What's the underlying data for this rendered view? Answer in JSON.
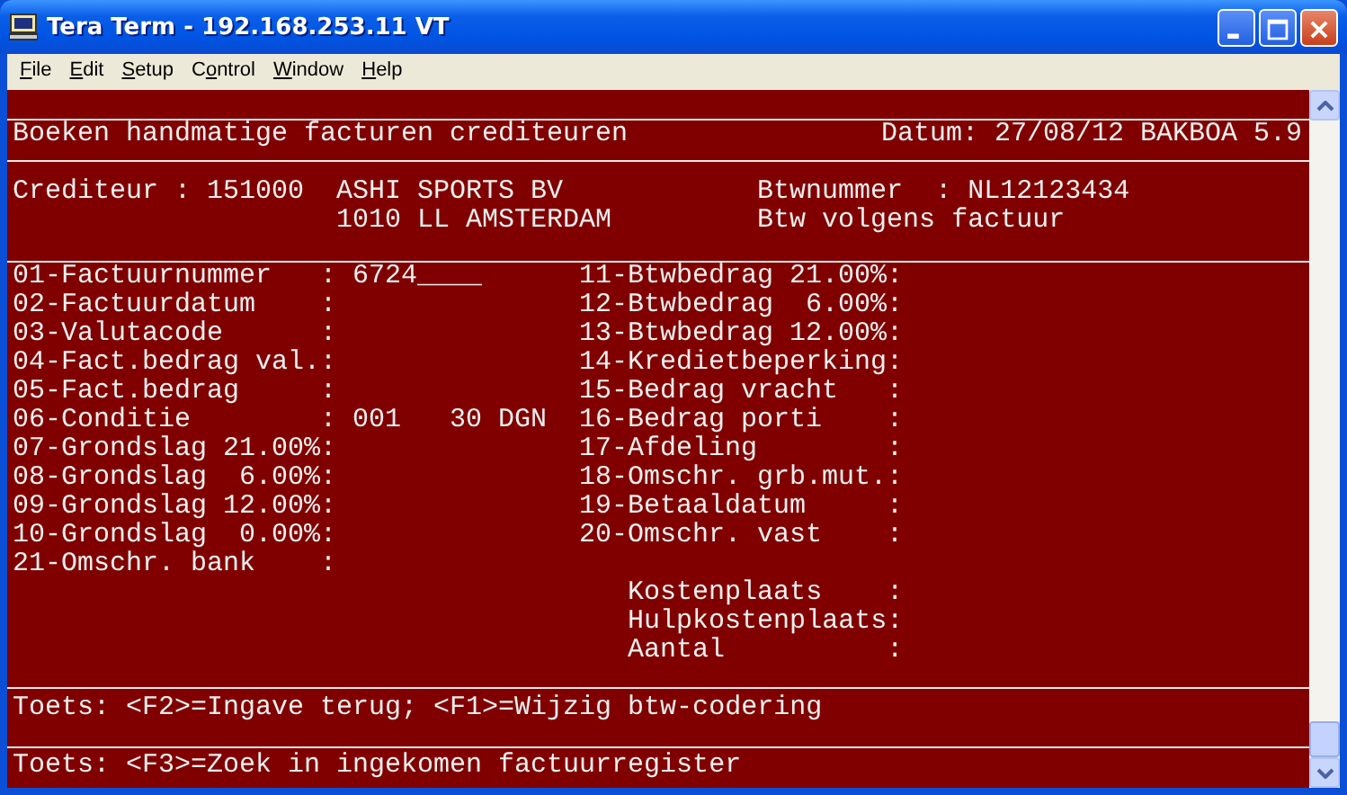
{
  "window": {
    "title": "Tera Term - 192.168.253.11 VT"
  },
  "menu": [
    {
      "mnemonic": "F",
      "rest": "ile"
    },
    {
      "mnemonic": "E",
      "rest": "dit"
    },
    {
      "mnemonic": "S",
      "rest": "etup"
    },
    {
      "before": "C",
      "mnemonic": "o",
      "rest": "ntrol"
    },
    {
      "mnemonic": "W",
      "rest": "indow"
    },
    {
      "mnemonic": "H",
      "rest": "elp"
    }
  ],
  "terminal": {
    "header": {
      "title": "Boeken handmatige facturen crediteuren",
      "date": "Datum: 27/08/12 BAKBOA 5.9"
    },
    "creditor": {
      "label": "Crediteur :",
      "number": "151000",
      "name": "ASHI SPORTS BV",
      "address": "1010 LL AMSTERDAM",
      "vat_label": "Btwnummer  :",
      "vat_number": "NL12123434",
      "vat_note": "Btw volgens factuur"
    },
    "fields_left": [
      {
        "label": "01-Factuurnummer   :",
        "value": "6724____"
      },
      {
        "label": "02-Factuurdatum    :"
      },
      {
        "label": "03-Valutacode      :"
      },
      {
        "label": "04-Fact.bedrag val.:"
      },
      {
        "label": "05-Fact.bedrag     :"
      },
      {
        "label": "06-Conditie        :",
        "value": "001   30 DGN"
      },
      {
        "label": "07-Grondslag 21.00%:"
      },
      {
        "label": "08-Grondslag  6.00%:"
      },
      {
        "label": "09-Grondslag 12.00%:"
      },
      {
        "label": "10-Grondslag  0.00%:"
      },
      {
        "label": "21-Omschr. bank    :"
      }
    ],
    "fields_right": [
      {
        "label": "11-Btwbedrag 21.00%:"
      },
      {
        "label": "12-Btwbedrag  6.00%:"
      },
      {
        "label": "13-Btwbedrag 12.00%:"
      },
      {
        "label": "14-Kredietbeperking:"
      },
      {
        "label": "15-Bedrag vracht   :"
      },
      {
        "label": "16-Bedrag porti    :"
      },
      {
        "label": "17-Afdeling        :"
      },
      {
        "label": "18-Omschr. grb.mut.:"
      },
      {
        "label": "19-Betaaldatum     :"
      },
      {
        "label": "20-Omschr. vast    :"
      }
    ],
    "cost_fields": [
      {
        "label": "Kostenplaats    :"
      },
      {
        "label": "Hulpkostenplaats:"
      },
      {
        "label": "Aantal          :"
      }
    ],
    "hints": [
      "Toets: <F2>=Ingave terug; <F1>=Wijzig btw-codering",
      "Toets: <F3>=Zoek in ingekomen factuurregister"
    ]
  }
}
